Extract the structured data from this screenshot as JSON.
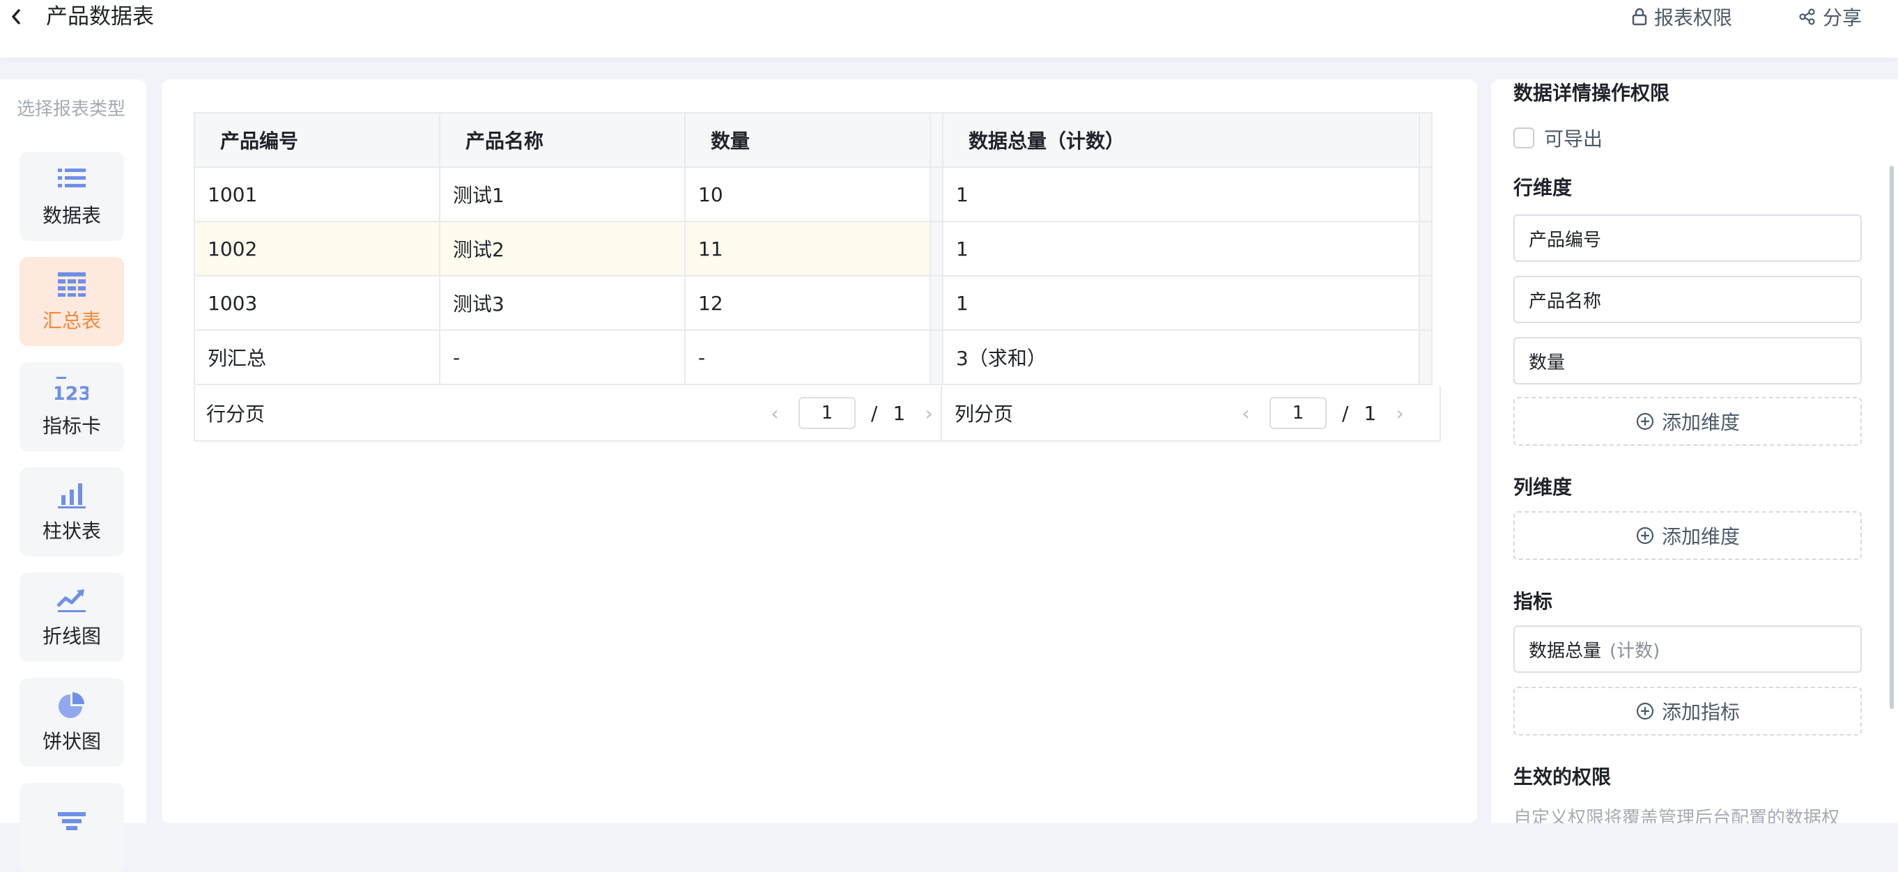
{
  "header": {
    "title": "产品数据表",
    "permission_label": "报表权限",
    "share_label": "分享"
  },
  "left_panel": {
    "title": "选择报表类型",
    "types": [
      {
        "label": "数据表",
        "icon": "list-icon"
      },
      {
        "label": "汇总表",
        "icon": "grid-table-icon",
        "active": true
      },
      {
        "label": "指标卡",
        "icon": "number-card-icon"
      },
      {
        "label": "柱状表",
        "icon": "bar-chart-icon"
      },
      {
        "label": "折线图",
        "icon": "line-chart-icon"
      },
      {
        "label": "饼状图",
        "icon": "pie-chart-icon"
      },
      {
        "label": "",
        "icon": "funnel-icon"
      }
    ],
    "accent_color": "#f08a3e",
    "icon_color": "#6f8fe8"
  },
  "table": {
    "headers": [
      "产品编号",
      "产品名称",
      "数量",
      "数据总量（计数）"
    ],
    "rows": [
      [
        "1001",
        "测试1",
        "10",
        "1"
      ],
      [
        "1002",
        "测试2",
        "11",
        "1"
      ],
      [
        "1003",
        "测试3",
        "12",
        "1"
      ]
    ],
    "summary_row": [
      "列汇总",
      "-",
      "-",
      "3（求和）"
    ],
    "highlight_row_color": "#fffbef"
  },
  "pager": {
    "row": {
      "label": "行分页",
      "page": "1",
      "total": "1",
      "slash": "/"
    },
    "col": {
      "label": "列分页",
      "page": "1",
      "total": "1",
      "slash": "/"
    }
  },
  "settings": {
    "detail_perm_title": "数据详情操作权限",
    "exportable_label": "可导出",
    "row_dim_title": "行维度",
    "row_dims": [
      "产品编号",
      "产品名称",
      "数量"
    ],
    "add_dim_label": "添加维度",
    "col_dim_title": "列维度",
    "metric_title": "指标",
    "metric_name": "数据总量",
    "metric_agg": "(计数)",
    "add_metric_label": "添加指标",
    "effective_perm_title": "生效的权限",
    "effective_perm_desc": "自定义权限将覆盖管理后台配置的数据权"
  }
}
